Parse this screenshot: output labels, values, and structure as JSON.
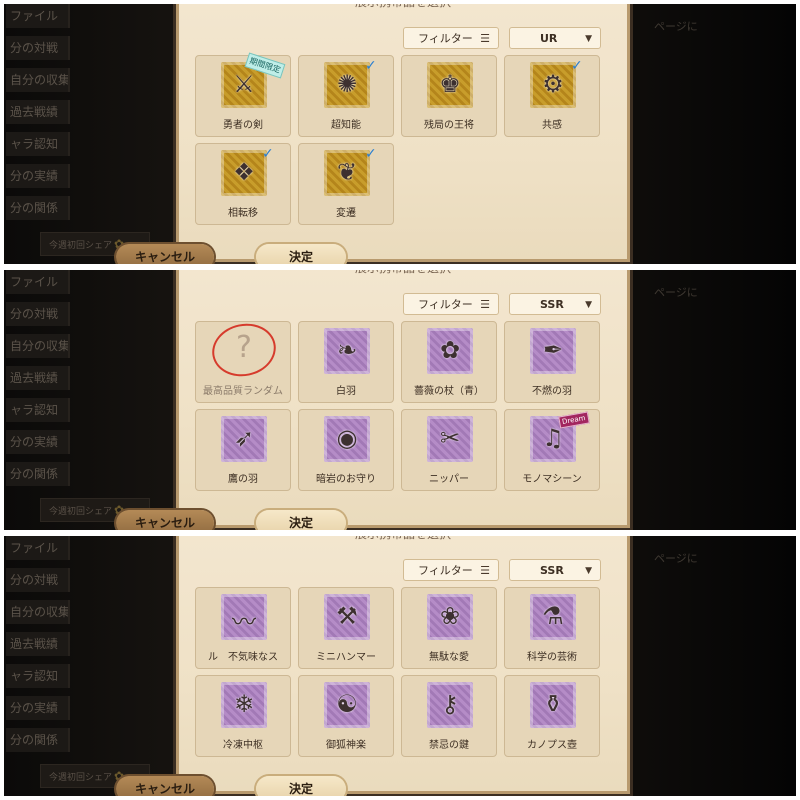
{
  "panels": [
    {
      "dialog_title": "展示携帯品を選択",
      "filter_label": "フィルター",
      "filter_icon": "list-filter-icon",
      "rarity": "UR",
      "cancel_label": "キャンセル",
      "confirm_label": "決定",
      "side_menu": [
        "ファイル",
        "分の対戦",
        "自分の収集",
        "過去戦績",
        "ャラ認知",
        "分の実績",
        "分の関係"
      ],
      "share_label": "今週初回シェア",
      "right_hint": "ページに",
      "rows": [
        [
          {
            "name": "勇者の剣",
            "color": "gold",
            "icon": "sword-icon",
            "badge": "promo-tag",
            "badge_text": "期間限定"
          },
          {
            "name": "超知能",
            "color": "gold",
            "icon": "brain-icon",
            "badge": "check-mark"
          },
          {
            "name": "残局の王将",
            "color": "gold",
            "icon": "chess-king-icon"
          },
          {
            "name": "共感",
            "color": "gold",
            "icon": "gear-icon",
            "badge": "check-mark"
          }
        ],
        [
          {
            "name": "相転移",
            "color": "gold",
            "icon": "crystal-icon",
            "badge": "check-mark"
          },
          {
            "name": "変遷",
            "color": "gold",
            "icon": "butterfly-icon",
            "badge": "check-mark"
          },
          null,
          null
        ]
      ]
    },
    {
      "dialog_title": "展示携帯品を選択",
      "filter_label": "フィルター",
      "filter_icon": "list-filter-icon",
      "rarity": "SSR",
      "cancel_label": "キャンセル",
      "confirm_label": "決定",
      "side_menu": [
        "ファイル",
        "分の対戦",
        "自分の収集",
        "過去戦績",
        "ャラ認知",
        "分の実績",
        "分の関係"
      ],
      "share_label": "今週初回シェア",
      "right_hint": "ページに",
      "rows": [
        [
          {
            "name": "最高品質ランダム",
            "color": "random",
            "icon": "question-mark-icon"
          },
          {
            "name": "白羽",
            "color": "purple",
            "icon": "feather-icon"
          },
          {
            "name": "薔薇の杖（青）",
            "color": "purple",
            "icon": "rose-cane-icon"
          },
          {
            "name": "不燃の羽",
            "color": "purple",
            "icon": "quill-icon"
          }
        ],
        [
          {
            "name": "鷹の羽",
            "color": "purple",
            "icon": "hawk-feather-icon"
          },
          {
            "name": "暗岩のお守り",
            "color": "purple",
            "icon": "amulet-icon"
          },
          {
            "name": "ニッパー",
            "color": "purple",
            "icon": "nippers-icon"
          },
          {
            "name": "モノマシーン",
            "color": "purple",
            "icon": "music-box-icon",
            "badge": "skin-tag",
            "badge_text": "Dream"
          }
        ]
      ]
    },
    {
      "dialog_title": "展示携帯品を選択",
      "filter_label": "フィルター",
      "filter_icon": "list-filter-icon",
      "rarity": "SSR",
      "cancel_label": "キャンセル",
      "confirm_label": "決定",
      "side_menu": [
        "ファイル",
        "分の対戦",
        "自分の収集",
        "過去戦績",
        "ャラ認知",
        "分の実績",
        "分の関係"
      ],
      "share_label": "今週初回シェア",
      "right_hint": "ページに",
      "rows": [
        [
          {
            "name": "ル　不気味なス",
            "color": "purple",
            "icon": "scarf-icon"
          },
          {
            "name": "ミニハンマー",
            "color": "purple",
            "icon": "hammer-icon"
          },
          {
            "name": "無駄な愛",
            "color": "purple",
            "icon": "bouquet-icon"
          },
          {
            "name": "科学の芸術",
            "color": "purple",
            "icon": "science-device-icon"
          }
        ],
        [
          {
            "name": "冷凍中枢",
            "color": "purple",
            "icon": "freeze-core-icon"
          },
          {
            "name": "御狐神楽",
            "color": "purple",
            "icon": "fox-mask-icon"
          },
          {
            "name": "禁忌の鍵",
            "color": "purple",
            "icon": "key-icon"
          },
          {
            "name": "カノプス壺",
            "color": "purple",
            "icon": "canopic-jar-icon"
          }
        ]
      ]
    }
  ]
}
